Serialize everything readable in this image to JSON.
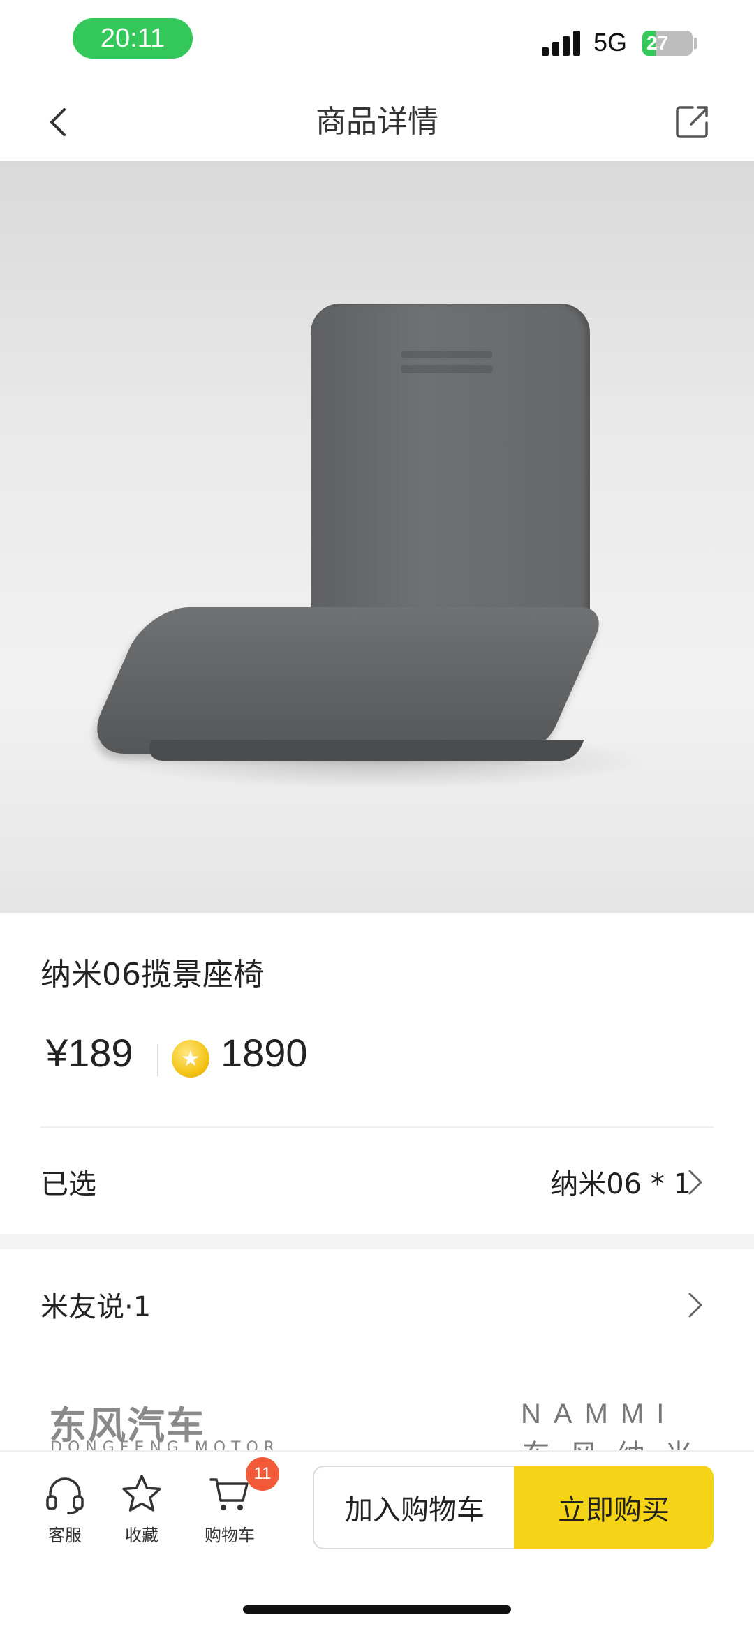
{
  "status_bar": {
    "time": "20:11",
    "network": "5G",
    "battery": "27",
    "battery_level": 0.27
  },
  "navbar": {
    "title": "商品详情",
    "back_icon": "chevron-left-icon",
    "share_icon": "share-icon"
  },
  "product": {
    "title": "纳米06揽景座椅",
    "price": "¥189",
    "points": "1890",
    "selected_label": "已选",
    "selected_value": "纳米06 * 1"
  },
  "reviews": {
    "label": "米友说·1"
  },
  "brands": {
    "left": "东风汽车",
    "left_sub": "DONGFENG MOTOR",
    "right": "NAMMI",
    "right_sub": "东风纳米"
  },
  "bottom_bar": {
    "service": "客服",
    "favorite": "收藏",
    "cart": "购物车",
    "cart_count": "11",
    "add_to_cart": "加入购物车",
    "buy_now": "立即购买"
  }
}
